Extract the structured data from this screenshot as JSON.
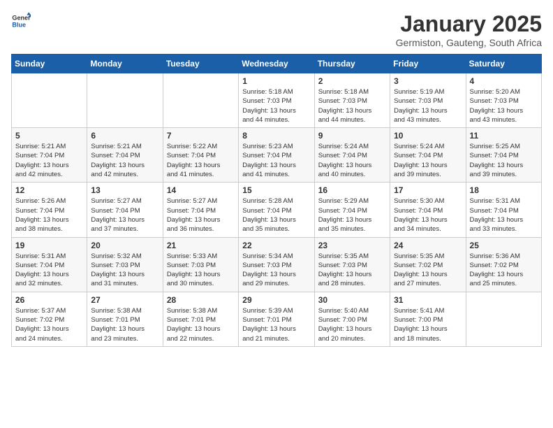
{
  "logo": {
    "line1": "General",
    "line2": "Blue"
  },
  "header": {
    "title": "January 2025",
    "subtitle": "Germiston, Gauteng, South Africa"
  },
  "weekdays": [
    "Sunday",
    "Monday",
    "Tuesday",
    "Wednesday",
    "Thursday",
    "Friday",
    "Saturday"
  ],
  "weeks": [
    [
      {
        "day": "",
        "info": ""
      },
      {
        "day": "",
        "info": ""
      },
      {
        "day": "",
        "info": ""
      },
      {
        "day": "1",
        "info": "Sunrise: 5:18 AM\nSunset: 7:03 PM\nDaylight: 13 hours\nand 44 minutes."
      },
      {
        "day": "2",
        "info": "Sunrise: 5:18 AM\nSunset: 7:03 PM\nDaylight: 13 hours\nand 44 minutes."
      },
      {
        "day": "3",
        "info": "Sunrise: 5:19 AM\nSunset: 7:03 PM\nDaylight: 13 hours\nand 43 minutes."
      },
      {
        "day": "4",
        "info": "Sunrise: 5:20 AM\nSunset: 7:03 PM\nDaylight: 13 hours\nand 43 minutes."
      }
    ],
    [
      {
        "day": "5",
        "info": "Sunrise: 5:21 AM\nSunset: 7:04 PM\nDaylight: 13 hours\nand 42 minutes."
      },
      {
        "day": "6",
        "info": "Sunrise: 5:21 AM\nSunset: 7:04 PM\nDaylight: 13 hours\nand 42 minutes."
      },
      {
        "day": "7",
        "info": "Sunrise: 5:22 AM\nSunset: 7:04 PM\nDaylight: 13 hours\nand 41 minutes."
      },
      {
        "day": "8",
        "info": "Sunrise: 5:23 AM\nSunset: 7:04 PM\nDaylight: 13 hours\nand 41 minutes."
      },
      {
        "day": "9",
        "info": "Sunrise: 5:24 AM\nSunset: 7:04 PM\nDaylight: 13 hours\nand 40 minutes."
      },
      {
        "day": "10",
        "info": "Sunrise: 5:24 AM\nSunset: 7:04 PM\nDaylight: 13 hours\nand 39 minutes."
      },
      {
        "day": "11",
        "info": "Sunrise: 5:25 AM\nSunset: 7:04 PM\nDaylight: 13 hours\nand 39 minutes."
      }
    ],
    [
      {
        "day": "12",
        "info": "Sunrise: 5:26 AM\nSunset: 7:04 PM\nDaylight: 13 hours\nand 38 minutes."
      },
      {
        "day": "13",
        "info": "Sunrise: 5:27 AM\nSunset: 7:04 PM\nDaylight: 13 hours\nand 37 minutes."
      },
      {
        "day": "14",
        "info": "Sunrise: 5:27 AM\nSunset: 7:04 PM\nDaylight: 13 hours\nand 36 minutes."
      },
      {
        "day": "15",
        "info": "Sunrise: 5:28 AM\nSunset: 7:04 PM\nDaylight: 13 hours\nand 35 minutes."
      },
      {
        "day": "16",
        "info": "Sunrise: 5:29 AM\nSunset: 7:04 PM\nDaylight: 13 hours\nand 35 minutes."
      },
      {
        "day": "17",
        "info": "Sunrise: 5:30 AM\nSunset: 7:04 PM\nDaylight: 13 hours\nand 34 minutes."
      },
      {
        "day": "18",
        "info": "Sunrise: 5:31 AM\nSunset: 7:04 PM\nDaylight: 13 hours\nand 33 minutes."
      }
    ],
    [
      {
        "day": "19",
        "info": "Sunrise: 5:31 AM\nSunset: 7:04 PM\nDaylight: 13 hours\nand 32 minutes."
      },
      {
        "day": "20",
        "info": "Sunrise: 5:32 AM\nSunset: 7:03 PM\nDaylight: 13 hours\nand 31 minutes."
      },
      {
        "day": "21",
        "info": "Sunrise: 5:33 AM\nSunset: 7:03 PM\nDaylight: 13 hours\nand 30 minutes."
      },
      {
        "day": "22",
        "info": "Sunrise: 5:34 AM\nSunset: 7:03 PM\nDaylight: 13 hours\nand 29 minutes."
      },
      {
        "day": "23",
        "info": "Sunrise: 5:35 AM\nSunset: 7:03 PM\nDaylight: 13 hours\nand 28 minutes."
      },
      {
        "day": "24",
        "info": "Sunrise: 5:35 AM\nSunset: 7:02 PM\nDaylight: 13 hours\nand 27 minutes."
      },
      {
        "day": "25",
        "info": "Sunrise: 5:36 AM\nSunset: 7:02 PM\nDaylight: 13 hours\nand 25 minutes."
      }
    ],
    [
      {
        "day": "26",
        "info": "Sunrise: 5:37 AM\nSunset: 7:02 PM\nDaylight: 13 hours\nand 24 minutes."
      },
      {
        "day": "27",
        "info": "Sunrise: 5:38 AM\nSunset: 7:01 PM\nDaylight: 13 hours\nand 23 minutes."
      },
      {
        "day": "28",
        "info": "Sunrise: 5:38 AM\nSunset: 7:01 PM\nDaylight: 13 hours\nand 22 minutes."
      },
      {
        "day": "29",
        "info": "Sunrise: 5:39 AM\nSunset: 7:01 PM\nDaylight: 13 hours\nand 21 minutes."
      },
      {
        "day": "30",
        "info": "Sunrise: 5:40 AM\nSunset: 7:00 PM\nDaylight: 13 hours\nand 20 minutes."
      },
      {
        "day": "31",
        "info": "Sunrise: 5:41 AM\nSunset: 7:00 PM\nDaylight: 13 hours\nand 18 minutes."
      },
      {
        "day": "",
        "info": ""
      }
    ]
  ]
}
